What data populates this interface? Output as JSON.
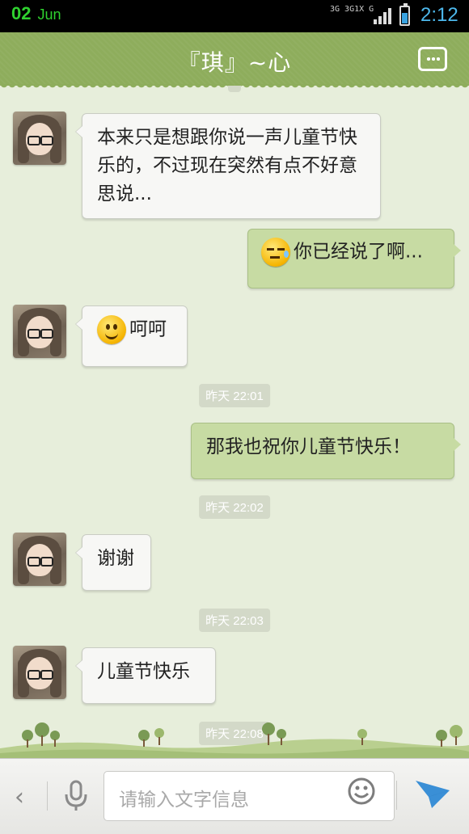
{
  "status_bar": {
    "day": "02",
    "month": "Jun",
    "network_top": "3G 3G1X G",
    "time": "2:12"
  },
  "header": {
    "title": "『琪』~心"
  },
  "messages": [
    {
      "side": "left",
      "text": "本来只是想跟你说一声儿童节快乐的，不过现在突然有点不好意思说..."
    },
    {
      "side": "right",
      "emoji": "sweat-face",
      "text": "你已经说了啊..."
    },
    {
      "side": "left",
      "emoji": "smile-face",
      "text": "呵呵"
    },
    {
      "timestamp": "昨天 22:01"
    },
    {
      "side": "right",
      "text": "那我也祝你儿童节快乐！"
    },
    {
      "timestamp": "昨天 22:02"
    },
    {
      "side": "left",
      "text": "谢谢"
    },
    {
      "timestamp": "昨天 22:03"
    },
    {
      "side": "left",
      "text": "儿童节快乐"
    },
    {
      "timestamp": "昨天 22:08"
    }
  ],
  "input": {
    "placeholder": "请输入文字信息"
  },
  "colors": {
    "header": "#8ead5c",
    "background": "#e7eedb",
    "outgoing_bubble": "#c7dba3",
    "incoming_bubble": "#f7f7f5",
    "send_icon": "#3a8fd6"
  }
}
